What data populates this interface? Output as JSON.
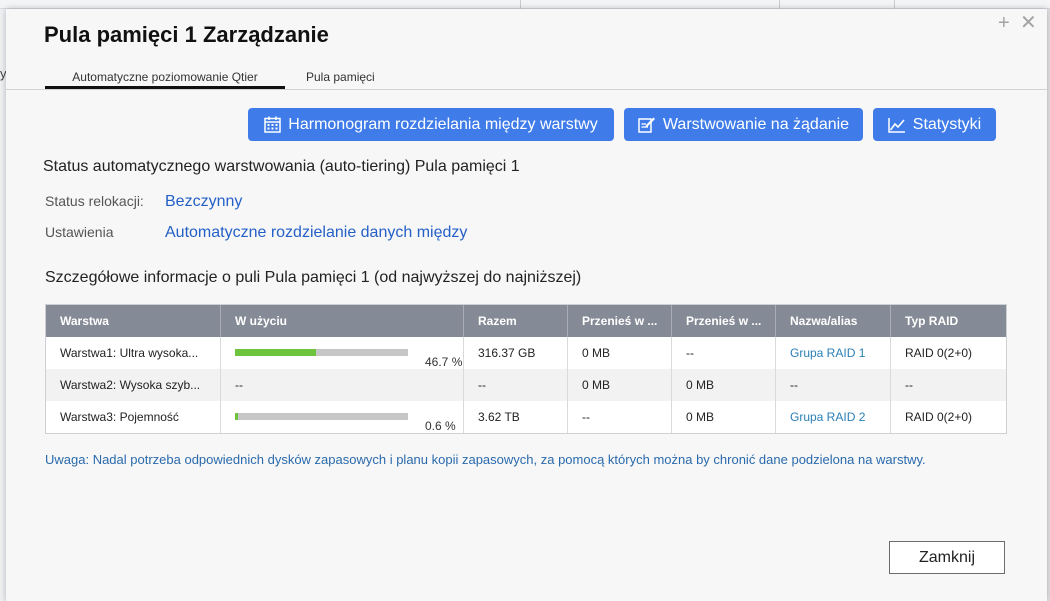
{
  "window": {
    "title": "Pula pamięci 1 Zarządzanie",
    "add_glyph": "+",
    "close_glyph": "✕"
  },
  "background": {
    "edge_text": "y"
  },
  "tabs": [
    {
      "label": "Automatyczne poziomowanie Qtier",
      "active": true
    },
    {
      "label": "Pula pamięci",
      "active": false
    }
  ],
  "toolbar": {
    "schedule_label": "Harmonogram rozdzielania między warstwy",
    "schedule_icon": "calendar-icon",
    "tiering_label": "Warstwowanie na żądanie",
    "tiering_icon": "edit-icon",
    "stats_label": "Statystyki",
    "stats_icon": "line-chart-icon",
    "accent_color": "#3f7ce9"
  },
  "status": {
    "title": "Status automatycznego warstwowania (auto-tiering) Pula pamięci 1",
    "relocation_label": "Status relokacji:",
    "relocation_value": "Bezczynny",
    "settings_label": "Ustawienia",
    "settings_value": "Automatyczne rozdzielanie danych między"
  },
  "details": {
    "title": "Szczegółowe informacje o puli Pula pamięci 1 (od najwyższej do najniższej)",
    "columns": [
      "Warstwa",
      "W użyciu",
      "Razem",
      "Przenieś w ...",
      "Przenieś w ...",
      "Nazwa/alias",
      "Typ RAID"
    ],
    "rows": [
      {
        "tier": "Warstwa1: Ultra wysoka...",
        "usage_pct": "46.7 %",
        "usage_fraction": 0.467,
        "total": "316.37 GB",
        "move_up": "0 MB",
        "move_down": "--",
        "alias": "Grupa RAID 1",
        "raid": "RAID 0(2+0)"
      },
      {
        "tier": "Warstwa2: Wysoka szyb...",
        "usage_text": "--",
        "total": "--",
        "move_up": "0 MB",
        "move_down": "0 MB",
        "alias": "--",
        "raid": "--"
      },
      {
        "tier": "Warstwa3: Pojemność",
        "usage_pct": "0.6 %",
        "usage_fraction": 0.006,
        "total": "3.62 TB",
        "move_up": "--",
        "move_down": "0 MB",
        "alias": "Grupa RAID 2",
        "raid": "RAID 0(2+0)"
      }
    ],
    "usage_bar_color": "#6fc43e",
    "header_color": "#858b96"
  },
  "note": "Uwaga: Nadal potrzeba odpowiednich dysków zapasowych i planu kopii zapasowych, za pomocą których można by chronić dane podzielona na warstwy.",
  "footer": {
    "close_label": "Zamknij"
  }
}
